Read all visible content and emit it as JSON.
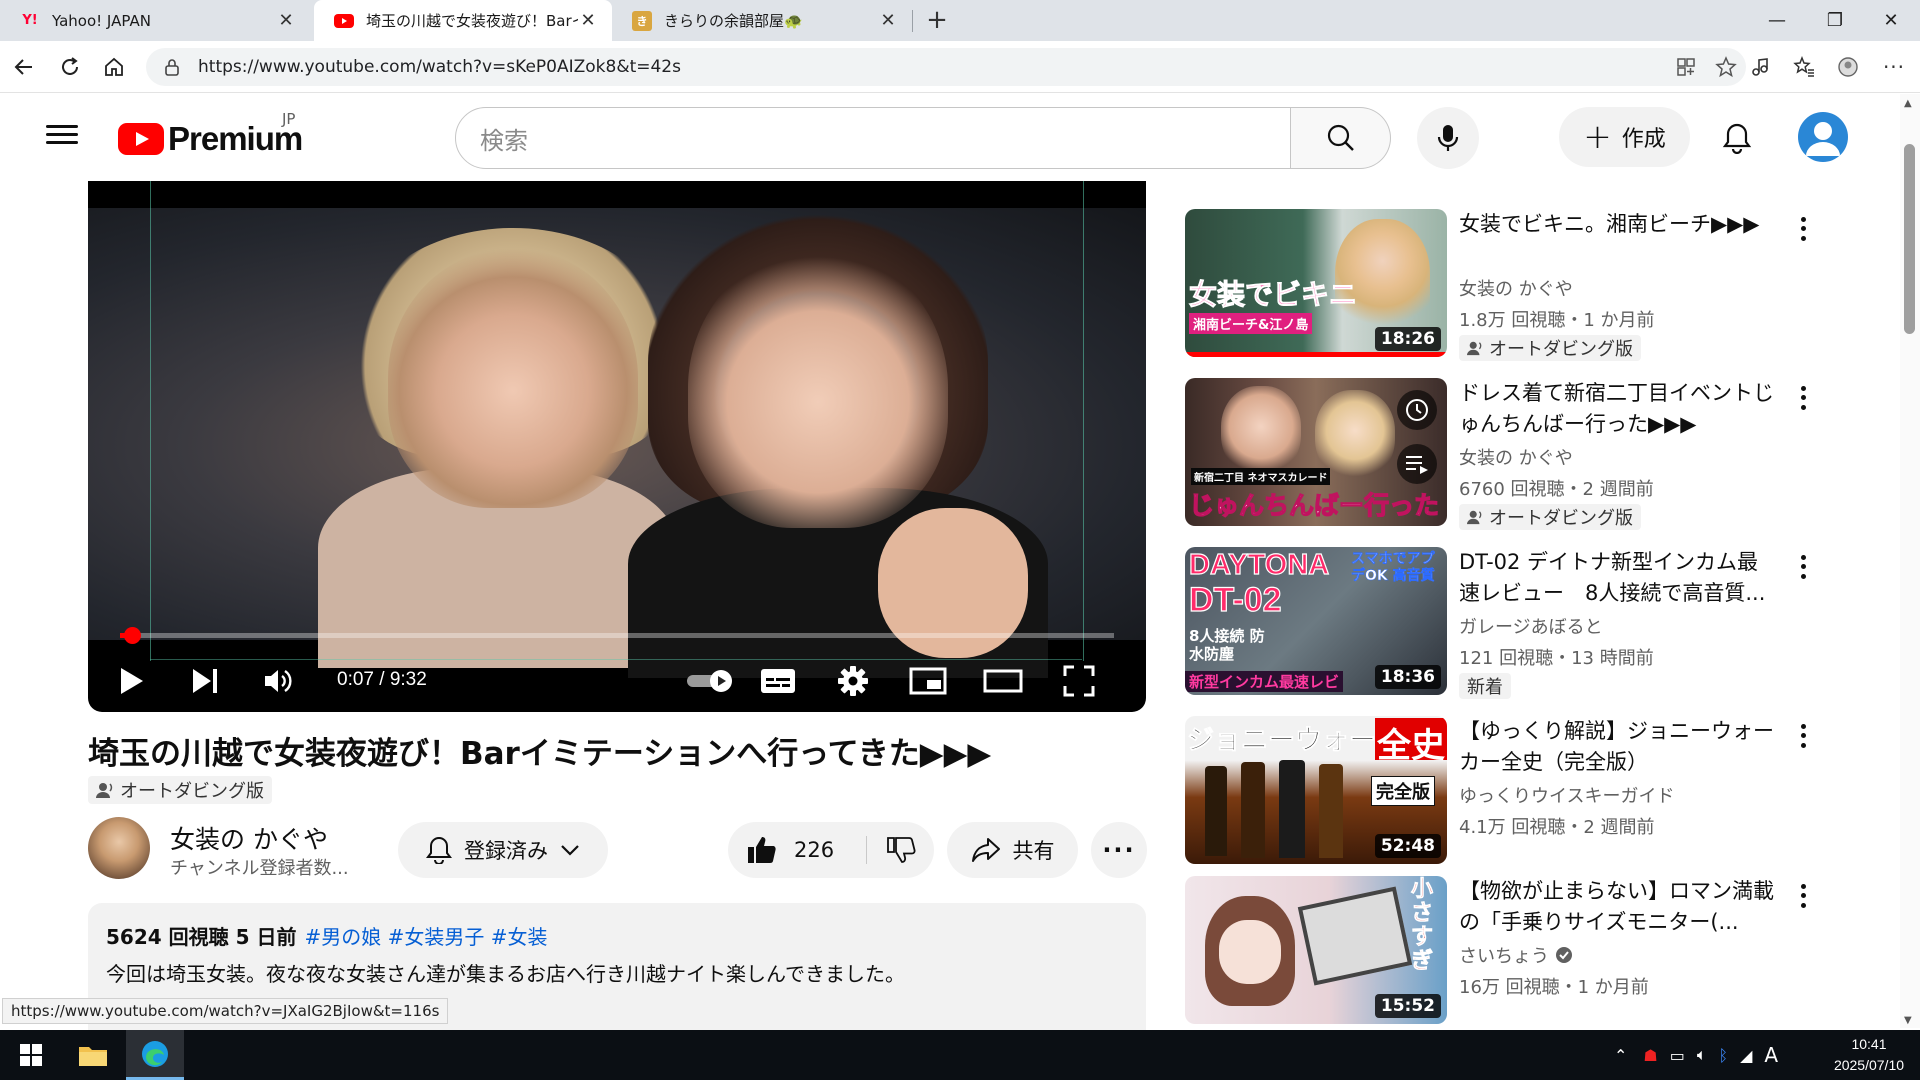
{
  "browser": {
    "tabs": [
      {
        "title": "Yahoo! JAPAN",
        "active": false
      },
      {
        "title": "埼玉の川越で女装夜遊び！Barイミテ",
        "active": true
      },
      {
        "title": "きらりの余韻部屋🐢",
        "active": false
      }
    ],
    "new_tab": "+",
    "url": "https://www.youtube.com/watch?v=sKeP0AIZok8&t=42s",
    "status_url": "https://www.youtube.com/watch?v=JXaIG2BjIow&t=116s"
  },
  "masthead": {
    "logo_word": "Premium",
    "country_code": "JP",
    "search_placeholder": "検索",
    "create_label": "作成"
  },
  "player": {
    "timecode": "0:07 / 9:32",
    "progress_fraction": 0.012
  },
  "video": {
    "title": "埼玉の川越で女装夜遊び！Barイミテーションへ行ってきた▶▶▶",
    "dub_badge": "オートダビング版",
    "channel_name": "女装の かぐや",
    "channel_subs": "チャンネル登録者数...",
    "subscribe_label": "登録済み",
    "like_count": "226",
    "share_label": "共有",
    "desc_stats": "5624 回視聴  5 日前",
    "desc_tags": "#男の娘 #女装男子 #女装",
    "desc_text": "今回は埼玉女装。夜な夜な女装さん達が集まるお店へ行き川越ナイト楽しんできました。"
  },
  "recommendations": [
    {
      "title": "女装でビキニ。湘南ビーチ▶▶▶",
      "channel": "女装の かぐや",
      "meta": "1.8万 回視聴・1 か月前",
      "badge": "オートダビング版",
      "duration": "18:26",
      "verified": false
    },
    {
      "title": "ドレス着て新宿二丁目イベントじゅんちんばー行った▶▶▶",
      "channel": "女装の かぐや",
      "meta": "6760 回視聴・2 週間前",
      "badge": "オートダビング版",
      "duration": "",
      "verified": false
    },
    {
      "title": "DT-02 デイトナ新型インカム最速レビュー　8人接続で高音質...",
      "channel": "ガレージあぼると",
      "meta": "121 回視聴・13 時間前",
      "badge": "新着",
      "duration": "18:36",
      "verified": false
    },
    {
      "title": "【ゆっくり解説】ジョニーウォーカー全史（完全版）",
      "channel": "ゆっくりウイスキーガイド",
      "meta": "4.1万 回視聴・2 週間前",
      "badge": "",
      "duration": "52:48",
      "verified": false
    },
    {
      "title": "【物欲が止まらない】ロマン満載の「手乗りサイズモニター(...",
      "channel": "さいちょう",
      "meta": "16万 回視聴・1 か月前",
      "badge": "",
      "duration": "15:52",
      "verified": true
    }
  ],
  "thumb_text": {
    "t1": "女装でビキニ",
    "t1b": "湘南ビーチ&江ノ島",
    "t2a": "新宿二丁目 ネオマスカレード",
    "t2": "じゅんちんばー行った",
    "t3a": "DAYTONA",
    "t3b": "DT-02",
    "t3c": "スマホでアプデOK 高音質",
    "t3d": "8人接続 防水防塵",
    "t3e": "新型インカム最速レビ",
    "t4a": "ジョニーウォーカー",
    "t4b": "全史",
    "t4c": "完全版",
    "t5": "小さすぎ"
  },
  "taskbar": {
    "time": "10:41",
    "date": "2025/07/10",
    "ime": "A"
  },
  "colors": {
    "youtube_red": "#ff0000",
    "link_blue": "#065fd4",
    "chip_bg": "#f2f2f2"
  }
}
